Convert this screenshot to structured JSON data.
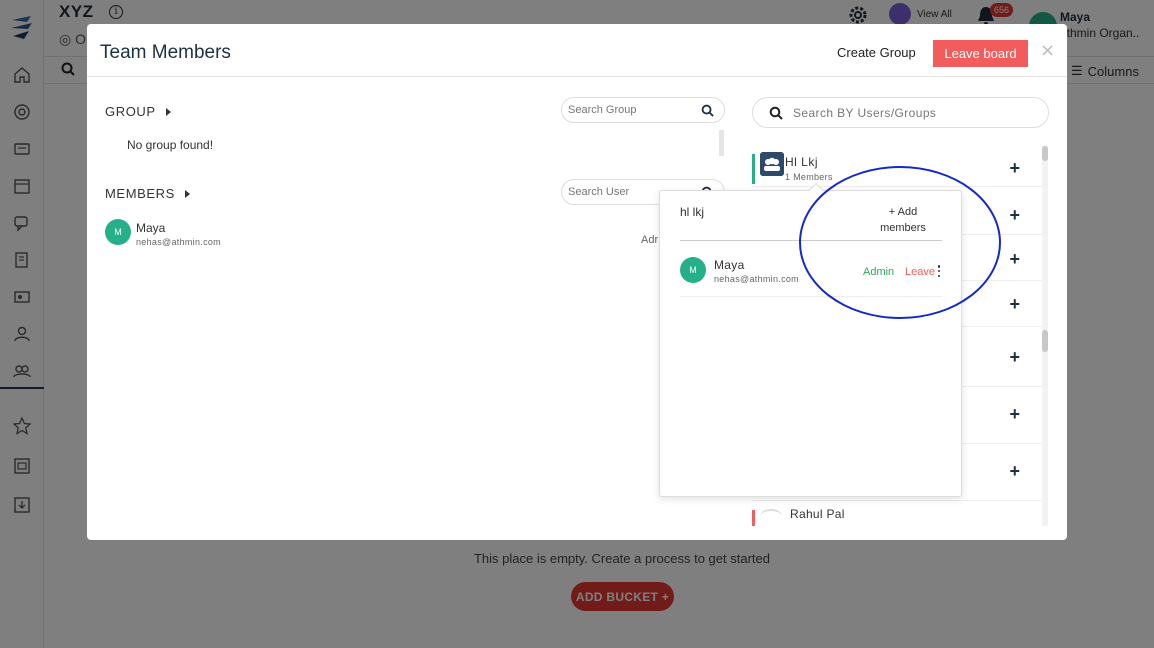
{
  "app": {
    "title": "XYZ",
    "sub_initial": "O",
    "info_icon": "i",
    "view_all": "View All",
    "notification_count": "656",
    "user_name": "Maya",
    "user_org": "athmin Organ..",
    "columns_label": "Columns",
    "empty_message": "This place is empty. Create a process to get started",
    "add_bucket_label": "ADD BUCKET +"
  },
  "sidebar_icons": [
    "home-icon",
    "target-icon",
    "card-icon",
    "calendar-icon",
    "chat-icon",
    "document-edit-icon",
    "gallery-icon",
    "user-icon",
    "team-icon",
    "star-icon",
    "image-board-icon",
    "download-icon"
  ],
  "modal": {
    "title": "Team Members",
    "create_group_label": "Create Group",
    "leave_board_label": "Leave board",
    "close_label": "×",
    "group_section": {
      "label": "GROUP",
      "search_placeholder": "Search Group",
      "empty_message": "No group found!"
    },
    "members_section": {
      "label": "MEMBERS",
      "search_placeholder": "Search User",
      "members": [
        {
          "initial": "M",
          "name": "Maya",
          "email": "nehas@athmin.com",
          "role_truncated": "Adr"
        }
      ]
    },
    "right_panel": {
      "search_placeholder": "Search BY Users/Groups",
      "group_row": {
        "name": "Hl Lkj",
        "count": "1 Members",
        "action": "+"
      },
      "plus_label": "+",
      "last_row": {
        "name": "Rahul Pal"
      }
    },
    "popover": {
      "title": "hl lkj",
      "add_members_label": "+ Add members",
      "member": {
        "initial": "M",
        "name": "Maya",
        "email": "nehas@athmin.com",
        "role": "Admin",
        "leave_label": "Leave"
      }
    }
  },
  "colors": {
    "accent_red": "#f25c5c",
    "avatar_green": "#26b08a",
    "admin_green": "#2eaa4f",
    "annotation_blue": "#1329c9",
    "navy": "#1f3045"
  }
}
